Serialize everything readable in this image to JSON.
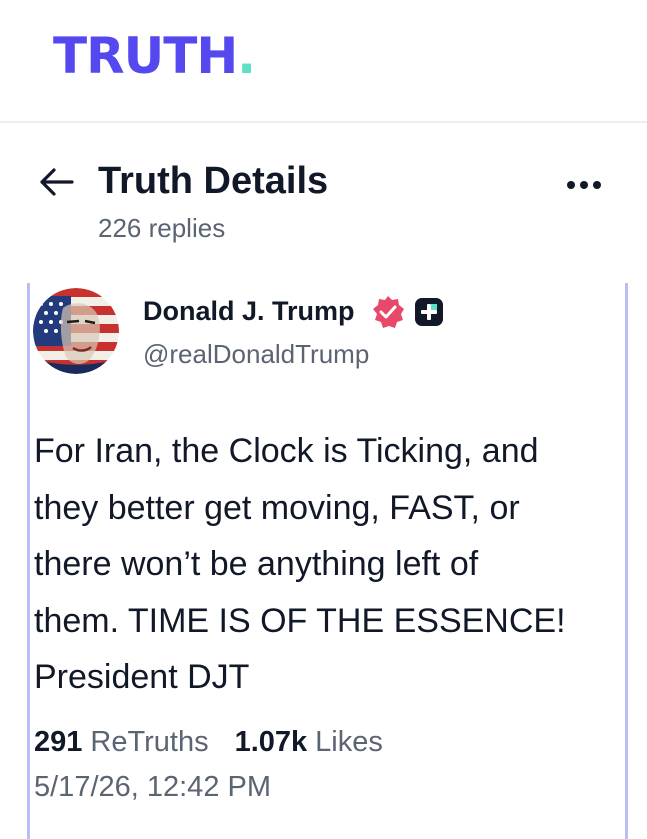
{
  "app": {
    "logo_text": "TRUTH",
    "logo_dot": ".",
    "brand_color": "#5448ee",
    "dot_color": "#5ce1c4"
  },
  "header": {
    "back_icon": "arrow-left-icon",
    "title": "Truth Details",
    "replies": "226 replies",
    "more_icon": "ellipsis-icon"
  },
  "post": {
    "author": {
      "name": "Donald J. Trump",
      "handle": "@realDonaldTrump",
      "verified_icon": "verified-badge-icon",
      "verified_color": "#e8496a",
      "plus_icon": "plus-badge-icon"
    },
    "text": "For Iran, the Clock is Ticking, and\nthey better get moving, FAST, or\nthere won’t be anything left of\nthem. TIME IS OF THE ESSENCE!\nPresident DJT",
    "stats": {
      "retruths_count": "291",
      "retruths_label": "ReTruths",
      "likes_count": "1.07k",
      "likes_label": "Likes"
    },
    "timestamp": "5/17/26, 12:42 PM"
  }
}
